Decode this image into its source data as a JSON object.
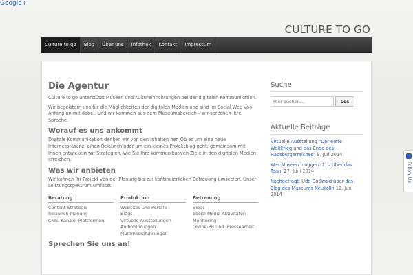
{
  "top_link": "Google+",
  "site_title": "CULTURE TO GO",
  "nav": [
    "Culture to go",
    "Blog",
    "Über uns",
    "Infothek",
    "Kontakt",
    "Impressum"
  ],
  "main": {
    "title": "Die Agentur",
    "intro": "Culture to go unterstützt Museen und Kultureinrichtungen bei der digitalen Kommunikation.",
    "intro2": "Wir begeistern uns für die Möglichkeiten der digitalen Medien und sind im Social Web von Anfang an mit dabei. Und wir kommen aus dem Museumsbereich – wir sprechen Ihre Sprache.",
    "h2_1": "Worauf es uns ankommt",
    "p_1": "Digitale Kommunikation denken wir von den Inhalten her. Ob es um eine neue Internetpräsenz, einen Relaunch oder um ein kleines Projektblog geht: gemeinsam mit Ihnen entwickeln wir Strategien, wie Sie Ihre kommunikativen Ziele in den digitalen Medien erreichen.",
    "h2_2": "Was wir anbieten",
    "p_2": "Wir können Ihr Projekt von der Planung bis zur kontinuierlichen Betreuung umsetzen. Unser Leistungsspektrum umfasst:",
    "columns": [
      {
        "head": "Beratung",
        "items": [
          "Content-Strategie",
          "Relaunch-Planung",
          "CMS, Kanäle, Plattformen"
        ]
      },
      {
        "head": "Produktion",
        "items": [
          "Websites und Portale",
          "Blogs",
          "Virtuelle Ausstellungen",
          "Audioführungen",
          "Multimediaführungen"
        ]
      },
      {
        "head": "Betreuung",
        "items": [
          "Blogs",
          "Social Media Aktivitäten",
          "Monitoring",
          "Online-PR und -Pressearbeit"
        ]
      }
    ],
    "h2_3": "Sprechen Sie uns an!"
  },
  "sidebar": {
    "search_title": "Suche",
    "search_placeholder": "Hier suchen...",
    "search_button": "Los",
    "recent_title": "Aktuelle Beiträge",
    "posts": [
      {
        "title": "Virtuelle Ausstellung \"Der erste Weltkrieg und das Ende des Habsburgerreiches\"",
        "date": "9. Juli 2014"
      },
      {
        "title": "Was Museen bloggen (1) – Über das Team",
        "date": "27. Juni 2014"
      },
      {
        "title": "Nachgefragt: Udo Gößwald über das Blog des Museums Neukölln",
        "date": "12. Juni 2014"
      }
    ]
  },
  "follow_label": "Follow Us",
  "colors": {
    "nav_bg": "#333333",
    "link": "#2a5db0"
  }
}
